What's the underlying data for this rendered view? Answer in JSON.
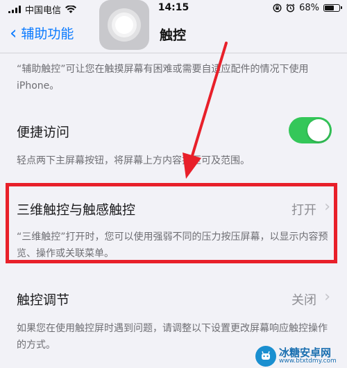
{
  "status_bar": {
    "carrier": "中国电信",
    "time": "14:15",
    "battery_percent": "68%",
    "battery_level": 0.68
  },
  "nav": {
    "back_label": "辅助功能",
    "title": "触控"
  },
  "assistive_touch_note": "“辅助触控”可让您在触摸屏幕有困难或需要自适应配件的情况下使用 iPhone。",
  "reachability": {
    "label": "便捷访问",
    "enabled": true,
    "note": "轻点两下主屏幕按钮，将屏幕上方内容拉至可及范围。"
  },
  "touch_3d": {
    "label": "三维触控与触感触控",
    "value": "打开",
    "note": "“三维触控”打开时，您可以使用强弱不同的压力按压屏幕，以显示内容预览、操作或关联菜单。"
  },
  "touch_accommodations": {
    "label": "触控调节",
    "value": "关闭",
    "note": "如果您在使用触控屏时遇到问题，请调整以下设置更改屏幕响应触控操作的方式。"
  },
  "watermark": {
    "name": "冰糖安卓网",
    "url": "www.btxtdmy.com"
  },
  "colors": {
    "accent": "#0a7aff",
    "toggle_on": "#34c759",
    "highlight": "#e8202a"
  }
}
